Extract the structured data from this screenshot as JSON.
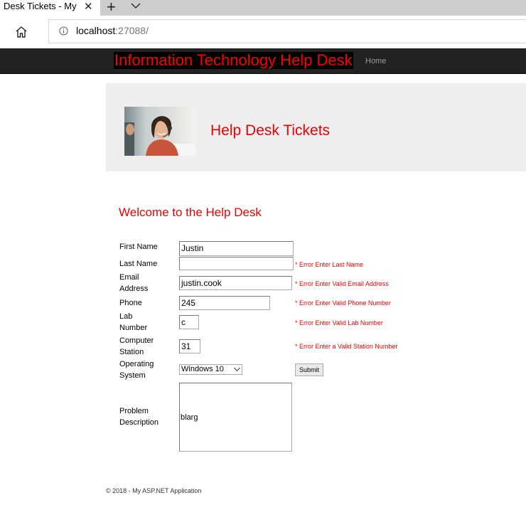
{
  "browser": {
    "tab_title": "Desk Tickets - My",
    "url_host": "localhost",
    "url_rest": ":27088/"
  },
  "site": {
    "brand": "Information Technology Help Desk",
    "nav": [
      "Home"
    ]
  },
  "jumbotron": {
    "title": "Help Desk Tickets",
    "image": "woman-with-headset-photo"
  },
  "form": {
    "heading": "Welcome to the Help Desk",
    "fields": {
      "first_name": {
        "label": "First Name",
        "value": "Justin",
        "error": ""
      },
      "last_name": {
        "label": "Last Name",
        "value": "",
        "error": "* Error Enter Last Name"
      },
      "email": {
        "label_line1": "Email",
        "label_line2": "Address",
        "value": "justin.cook",
        "error": "* Error Enter Valid Email Address"
      },
      "phone": {
        "label": "Phone",
        "value": "245",
        "error": "* Error Enter Valid Phone Number"
      },
      "lab_number": {
        "label_line1": "Lab",
        "label_line2": "Number",
        "value": "c",
        "error": "* Error Enter Valid Lab Number"
      },
      "computer_station": {
        "label_line1": "Computer",
        "label_line2": "Station",
        "value": "31",
        "error": "* Error Enter a Valid Station Number"
      },
      "operating_system": {
        "label_line1": "Operating",
        "label_line2": "System",
        "selected": "Windows 10"
      },
      "problem_description": {
        "label_line1": "Problem",
        "label_line2": "Description",
        "value": "blarg"
      }
    },
    "submit_label": "Submit"
  },
  "footer": {
    "text": "© 2018 - My ASP.NET Application"
  },
  "colors": {
    "accent": "#ff0000",
    "navbar": "#222222",
    "jumbotron": "#eeeeee"
  }
}
